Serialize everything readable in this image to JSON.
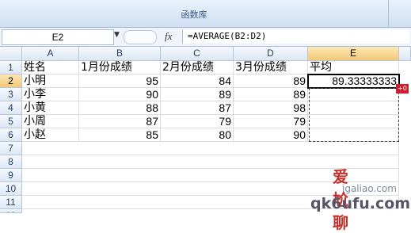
{
  "ribbon": {
    "group_label": "函数库"
  },
  "formula_bar": {
    "name_box": "E2",
    "fx": "fx",
    "formula": "=AVERAGE(B2:D2)"
  },
  "columns": [
    "A",
    "B",
    "C",
    "D",
    "E"
  ],
  "rows": [
    "1",
    "2",
    "3",
    "4",
    "5",
    "6",
    "7",
    "8",
    "9",
    "10",
    "11",
    "12"
  ],
  "sheet": {
    "header": [
      "姓名",
      "1月份成绩",
      "2月份成绩",
      "3月份成绩",
      "平均"
    ],
    "data": [
      [
        "小明",
        "95",
        "84",
        "89",
        "89.33333333"
      ],
      [
        "小李",
        "90",
        "89",
        "89",
        ""
      ],
      [
        "小黄",
        "88",
        "87",
        "98",
        ""
      ],
      [
        "小周",
        "87",
        "79",
        "79",
        ""
      ],
      [
        "小赵",
        "85",
        "80",
        "90",
        ""
      ]
    ]
  },
  "watermark": {
    "text": "爱尬聊",
    "url": "igaliao.com",
    "url2": "qk6ufu.com"
  }
}
